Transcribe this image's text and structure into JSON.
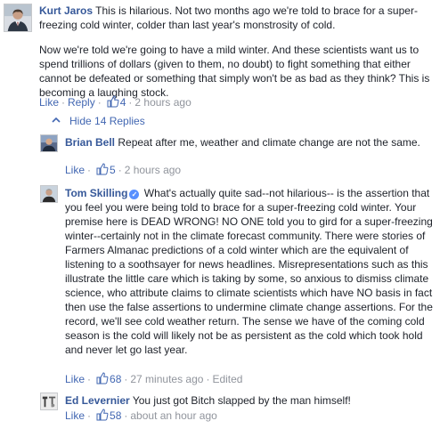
{
  "comments": [
    {
      "author": "Kurt Jaros",
      "text": "This is hilarious. Not two months ago we're told to brace for a super-freezing cold winter, colder than last year's monstrosity of cold.",
      "text2": "Now we're told we're going to have a mild winter. And these scientists want us to spend trillions of dollars (given to them, no doubt) to fight something that either cannot be defeated or something that simply won't be as bad as they think? This is becoming a laughing stock.",
      "like_label": "Like",
      "reply_label": "Reply",
      "likes": "4",
      "time": "2 hours ago",
      "avatar_icon": "person-avatar-icon"
    }
  ],
  "replies_toggle": {
    "label": "Hide 14 Replies"
  },
  "replies": [
    {
      "author": "Brian Bell",
      "text": "Repeat after me, weather and climate change are not the same.",
      "like_label": "Like",
      "likes": "5",
      "time": "2 hours ago"
    },
    {
      "author": "Tom Skilling",
      "verified": true,
      "text": "What's actually quite sad--not hilarious-- is the assertion that you feel you were being told to brace for a super-freezing cold winter. Your premise here is DEAD WRONG! NO ONE told you to gird for a super-freezing winter--certainly not in the climate forecast community. There were stories of Farmers Almanac predictions of a cold winter which are the equivalent of listening to a soothsayer for news headlines. Misrepresentations such as this illustrate the little care which is taking by some, so anxious to dismiss climate science, who attribute claims to climate scientists which have NO basis in fact then use the false assertions to undermine climate change assertions. For the record, we'll see cold weather return. The sense we have of the coming cold season is the cold will likely not be as persistent as the cold which took hold and never let go last year.",
      "like_label": "Like",
      "likes": "68",
      "time": "27 minutes ago",
      "edited": "Edited"
    },
    {
      "author": "Ed Levernier",
      "text": "You just got Bitch slapped by the man himself!",
      "like_label": "Like",
      "likes": "58",
      "time": "about an hour ago"
    }
  ],
  "colors": {
    "link": "#365899",
    "action": "#4267b2",
    "meta": "#90949c",
    "text": "#1d2129"
  }
}
